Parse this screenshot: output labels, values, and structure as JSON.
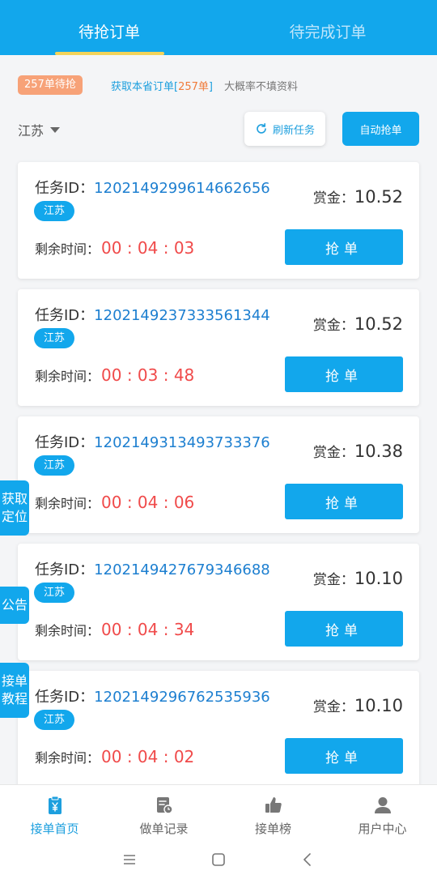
{
  "tabs": [
    {
      "label": "待抢订单",
      "active": true
    },
    {
      "label": "待完成订单",
      "active": false
    }
  ],
  "info": {
    "pending_badge": "257单待抢",
    "fetch_prefix": "获取本省订单[",
    "fetch_count": "257单",
    "fetch_suffix": "]",
    "tip": "大概率不填资料"
  },
  "filter": {
    "province": "江苏"
  },
  "actions": {
    "refresh": "刷新任务",
    "auto_grab": "自动抢单"
  },
  "labels": {
    "task_id": "任务ID：",
    "reward": "赏金：",
    "remaining": "剩余时间：",
    "grab": "抢单"
  },
  "orders": [
    {
      "id": "1202149299614662656",
      "region": "江苏",
      "reward": "10.52",
      "time": "00 : 04 : 03"
    },
    {
      "id": "1202149237333561344",
      "region": "江苏",
      "reward": "10.52",
      "time": "00 : 03 : 48"
    },
    {
      "id": "1202149313493733376",
      "region": "江苏",
      "reward": "10.38",
      "time": "00 : 04 : 06"
    },
    {
      "id": "1202149427679346688",
      "region": "江苏",
      "reward": "10.10",
      "time": "00 : 04 : 34"
    },
    {
      "id": "1202149296762535936",
      "region": "江苏",
      "reward": "10.10",
      "time": "00 : 04 : 02"
    }
  ],
  "side_buttons": {
    "location": "获取定位",
    "notice": "公告",
    "tutorial": "接单教程"
  },
  "bottom_nav": [
    {
      "label": "接单首页",
      "icon": "clipboard-yen-icon",
      "active": true
    },
    {
      "label": "做单记录",
      "icon": "record-doc-icon",
      "active": false
    },
    {
      "label": "接单榜",
      "icon": "thumbs-up-icon",
      "active": false
    },
    {
      "label": "用户中心",
      "icon": "user-icon",
      "active": false
    }
  ],
  "colors": {
    "primary": "#12a7ec",
    "badge": "#f7a278",
    "time": "#f04a4a",
    "underline": "#f3d35a"
  }
}
